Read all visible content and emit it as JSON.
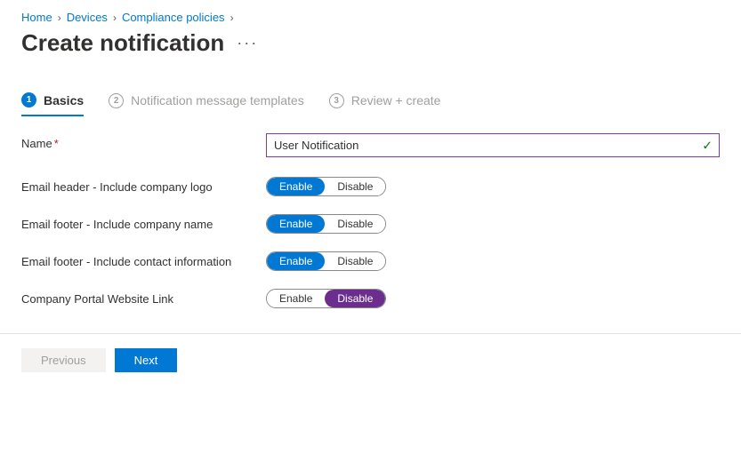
{
  "breadcrumb": {
    "items": [
      "Home",
      "Devices",
      "Compliance policies"
    ]
  },
  "page": {
    "title": "Create notification"
  },
  "steps": [
    {
      "num": "1",
      "label": "Basics"
    },
    {
      "num": "2",
      "label": "Notification message templates"
    },
    {
      "num": "3",
      "label": "Review + create"
    }
  ],
  "form": {
    "name_label": "Name",
    "name_value": "User Notification",
    "rows": [
      {
        "label": "Email header - Include company logo",
        "enable": "Enable",
        "disable": "Disable",
        "selected": "enable"
      },
      {
        "label": "Email footer - Include company name",
        "enable": "Enable",
        "disable": "Disable",
        "selected": "enable"
      },
      {
        "label": "Email footer - Include contact information",
        "enable": "Enable",
        "disable": "Disable",
        "selected": "enable"
      },
      {
        "label": "Company Portal Website Link",
        "enable": "Enable",
        "disable": "Disable",
        "selected": "disable"
      }
    ]
  },
  "footer": {
    "previous": "Previous",
    "next": "Next"
  }
}
